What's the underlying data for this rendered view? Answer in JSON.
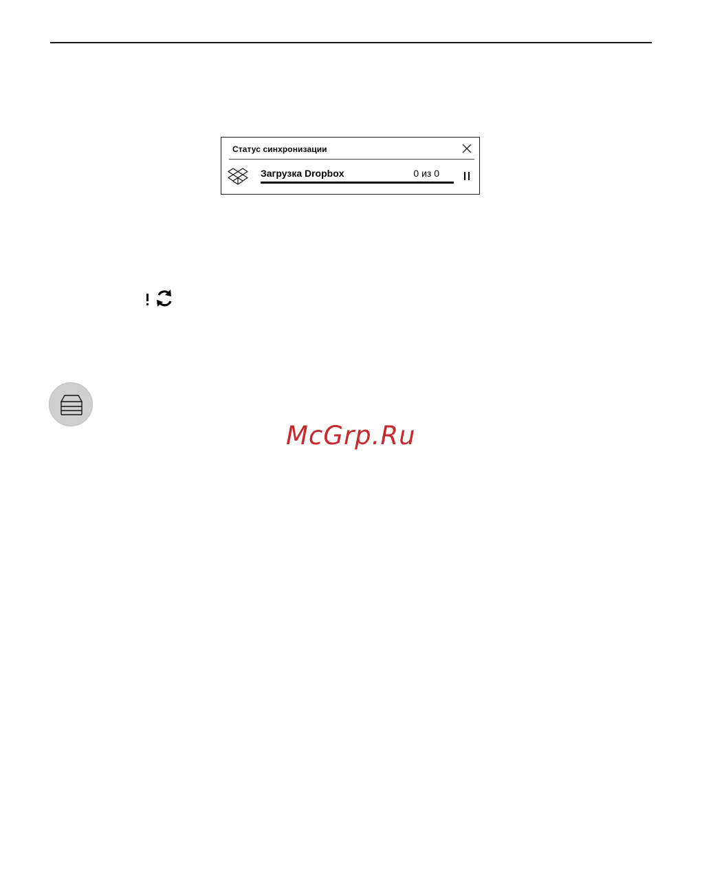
{
  "sync_dialog": {
    "title": "Статус синхронизации",
    "item_label": "Загрузка Dropbox",
    "item_count": "0 из 0",
    "progress_fraction": 1.0
  },
  "icons": {
    "close": "close-icon",
    "dropbox": "dropbox-icon",
    "pause": "pause-icon",
    "sync_error": "sync-error-icon",
    "bookshelf": "bookshelf-icon"
  },
  "watermark": {
    "text": "McGrp.Ru",
    "color": "#c8282c"
  }
}
